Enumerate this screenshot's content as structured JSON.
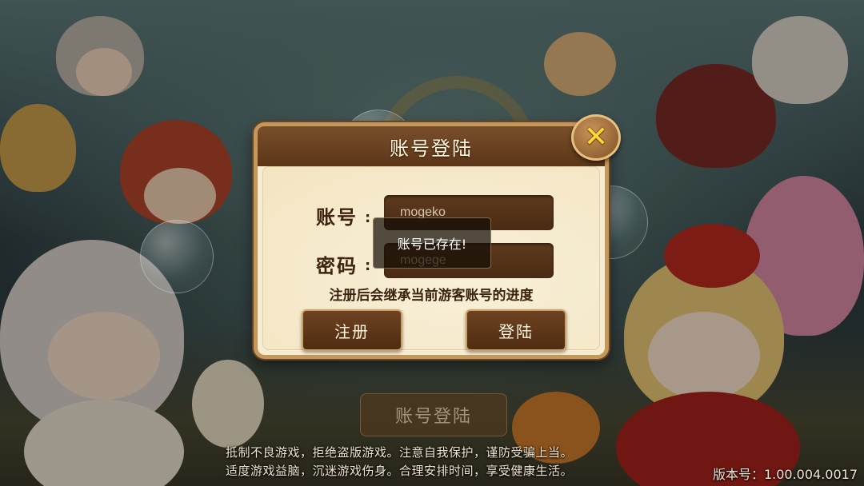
{
  "dialog": {
    "title": "账号登陆",
    "close_icon": "close-x-icon",
    "account_label": "账号",
    "password_label": "密码",
    "colon": ":",
    "account_value": "mogeko",
    "password_value": "mogege",
    "hint": "注册后会继承当前游客账号的进度",
    "register_label": "注册",
    "login_label": "登陆"
  },
  "toast": {
    "message": "账号已存在!"
  },
  "background": {
    "login_button_label": "账号登陆",
    "notice_line1": "抵制不良游戏，拒绝盗版游戏。注意自我保护，谨防受骗上当。",
    "notice_line2": "适度游戏益脑，沉迷游戏伤身。合理安排时间，享受健康生活。",
    "version": "版本号：1.00.004.0017"
  },
  "colors": {
    "panel_bg": "#f6ecd2",
    "panel_border": "#c4975a",
    "header_brown": "#5c3618",
    "close_x": "#ffd93a"
  }
}
